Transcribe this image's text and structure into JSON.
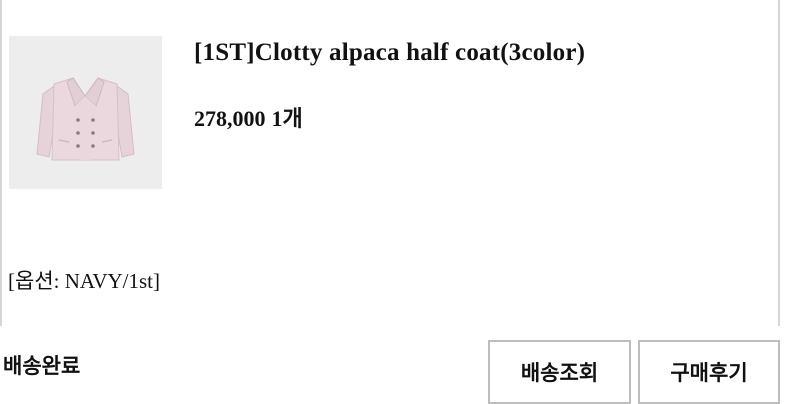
{
  "order_item": {
    "product_name": "[1ST]Clotty alpaca half coat(3color)",
    "price": "278,000",
    "quantity": "1개",
    "option": "[옵션: NAVY/1st]",
    "image_icon": "pink-double-breasted-coat-photo"
  },
  "footer": {
    "status": "배송완료",
    "track_label": "배송조회",
    "review_label": "구매후기"
  },
  "colors": {
    "coat": "#e8d6dc",
    "thumb_bg": "#ececec",
    "border": "#bdbdbd"
  }
}
